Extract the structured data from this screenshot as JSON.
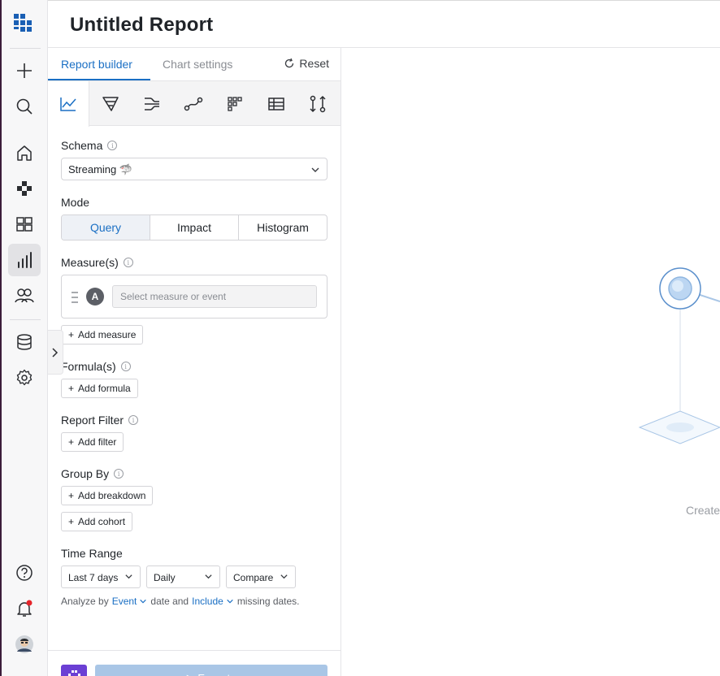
{
  "report": {
    "title": "Untitled Report"
  },
  "tabs": {
    "builder": "Report builder",
    "chart_settings": "Chart settings",
    "reset": "Reset"
  },
  "chart_types": [
    "line-chart-icon",
    "funnel-icon",
    "flows-icon",
    "path-icon",
    "retention-grid-icon",
    "table-icon",
    "compare-icon"
  ],
  "schema": {
    "label": "Schema",
    "value": "Streaming 🦈"
  },
  "mode": {
    "label": "Mode",
    "options": [
      "Query",
      "Impact",
      "Histogram"
    ],
    "selected": "Query"
  },
  "measures": {
    "label": "Measure(s)",
    "badge": "A",
    "placeholder": "Select measure or event",
    "add": "Add measure"
  },
  "formulas": {
    "label": "Formula(s)",
    "add": "Add formula"
  },
  "filter": {
    "label": "Report Filter",
    "add": "Add filter"
  },
  "group_by": {
    "label": "Group By",
    "add_breakdown": "Add breakdown",
    "add_cohort": "Add cohort"
  },
  "time_range": {
    "label": "Time Range",
    "range": "Last 7 days",
    "granularity": "Daily",
    "compare": "Compare",
    "analyze_prefix": "Analyze by",
    "analyze_event": "Event",
    "analyze_mid": "date and",
    "analyze_include": "Include",
    "analyze_suffix": "missing dates."
  },
  "footer": {
    "execute": "▷ Execute"
  },
  "canvas": {
    "create_text": "Create"
  },
  "colors": {
    "accent": "#1a6fc4",
    "notification": "#e5242a",
    "brand": "#1a5fb4"
  }
}
